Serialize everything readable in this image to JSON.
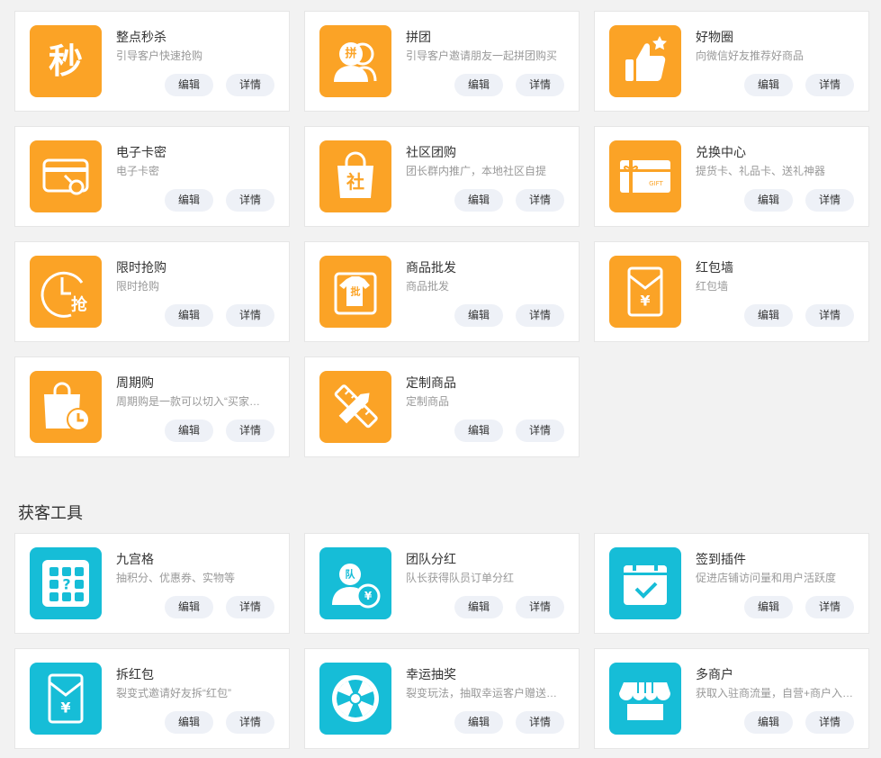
{
  "marketing": {
    "cards": [
      {
        "title": "整点秒杀",
        "desc": "引导客户快速抢购",
        "icon": "seckill-icon",
        "color": "orange",
        "glyph": "秒"
      },
      {
        "title": "拼团",
        "desc": "引导客户邀请朋友一起拼团购买",
        "icon": "group-buy-icon",
        "color": "orange",
        "glyph": "拼"
      },
      {
        "title": "好物圈",
        "desc": "向微信好友推荐好商品",
        "icon": "thumbs-up-star-icon",
        "color": "orange"
      },
      {
        "title": "电子卡密",
        "desc": "电子卡密",
        "icon": "card-key-icon",
        "color": "orange"
      },
      {
        "title": "社区团购",
        "desc": "团长群内推广，本地社区自提",
        "icon": "community-bag-icon",
        "color": "orange",
        "glyph": "社"
      },
      {
        "title": "兑换中心",
        "desc": "提货卡、礼品卡、送礼神器",
        "icon": "gift-card-icon",
        "color": "orange",
        "glyph": "GIFT"
      },
      {
        "title": "限时抢购",
        "desc": "限时抢购",
        "icon": "clock-flash-sale-icon",
        "color": "orange",
        "glyph": "抢"
      },
      {
        "title": "商品批发",
        "desc": "商品批发",
        "icon": "wholesale-shirt-icon",
        "color": "orange",
        "glyph": "批"
      },
      {
        "title": "红包墙",
        "desc": "红包墙",
        "icon": "red-envelope-icon",
        "color": "orange",
        "glyph": "¥"
      },
      {
        "title": "周期购",
        "desc": "周期购是一款可以切入“买家…",
        "icon": "periodic-bag-clock-icon",
        "color": "orange"
      },
      {
        "title": "定制商品",
        "desc": "定制商品",
        "icon": "pencil-ruler-icon",
        "color": "orange"
      }
    ]
  },
  "acquisition": {
    "section_title": "获客工具",
    "cards": [
      {
        "title": "九宫格",
        "desc": "抽积分、优惠券、实物等",
        "icon": "nine-grid-icon",
        "color": "teal",
        "glyph": "?"
      },
      {
        "title": "团队分红",
        "desc": "队长获得队员订单分红",
        "icon": "team-dividend-icon",
        "color": "teal",
        "glyph": "队"
      },
      {
        "title": "签到插件",
        "desc": "促进店铺访问量和用户活跃度",
        "icon": "calendar-check-icon",
        "color": "teal"
      },
      {
        "title": "拆红包",
        "desc": "裂变式邀请好友拆“红包”",
        "icon": "open-envelope-icon",
        "color": "teal",
        "glyph": "¥"
      },
      {
        "title": "幸运抽奖",
        "desc": "裂变玩法，抽取幸运客户赠送…",
        "icon": "lucky-wheel-icon",
        "color": "teal"
      },
      {
        "title": "多商户",
        "desc": "获取入驻商流量，自营+商户入…",
        "icon": "storefront-icon",
        "color": "teal"
      }
    ]
  },
  "buttons": {
    "edit": "编辑",
    "detail": "详情"
  }
}
